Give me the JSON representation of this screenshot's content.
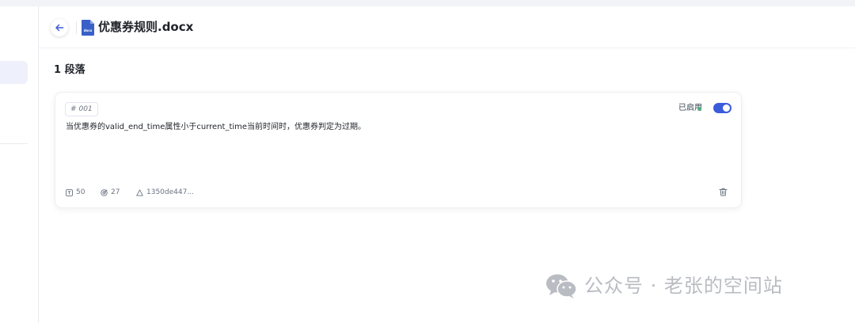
{
  "header": {
    "doc_title": "优惠券规则.docx",
    "doc_icon_label": "docx"
  },
  "section": {
    "title": "1 段落"
  },
  "segment": {
    "id": "001",
    "id_prefix": "#",
    "status_label": "已启用",
    "enabled": true,
    "content": "当优惠券的valid_end_time属性小于current_time当前时间时，优惠券判定为过期。",
    "tokens": "50",
    "hits": "27",
    "hash": "1350de447..."
  },
  "watermark": {
    "text": "公众号 · 老张的空间站"
  },
  "colors": {
    "accent": "#3b5bdb",
    "status_ok": "#4fb179",
    "doc_icon": "#3a5fc8"
  }
}
